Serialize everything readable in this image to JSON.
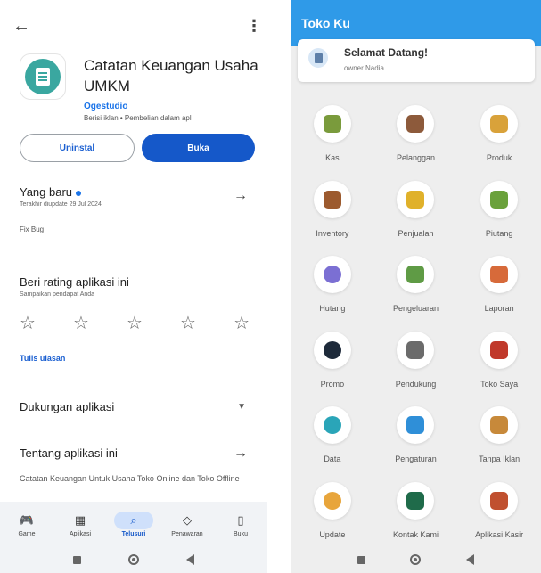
{
  "playstore": {
    "app_title": "Catatan Keuangan Usaha UMKM",
    "developer": "Ogestudio",
    "meta": "Berisi iklan • Pembelian dalam apl",
    "uninstall_label": "Uninstal",
    "open_label": "Buka",
    "whats_new": {
      "title": "Yang baru",
      "updated": "Terakhir diupdate 29 Jul 2024",
      "text": "Fix Bug"
    },
    "rate": {
      "title": "Beri rating aplikasi ini",
      "subtitle": "Sampaikan pendapat Anda",
      "star_count": 5,
      "write_review": "Tulis ulasan"
    },
    "support": {
      "title": "Dukungan aplikasi"
    },
    "about": {
      "title": "Tentang aplikasi ini",
      "text": "Catatan Keuangan Untuk Usaha Toko Online dan Toko Offline"
    },
    "bottom_nav": [
      {
        "label": "Game",
        "icon": "gamepad-icon",
        "glyph": "🎮",
        "active": false
      },
      {
        "label": "Aplikasi",
        "icon": "apps-grid-icon",
        "glyph": "▦",
        "active": false
      },
      {
        "label": "Telusuri",
        "icon": "search-icon",
        "glyph": "⌕",
        "active": true
      },
      {
        "label": "Penawaran",
        "icon": "tag-icon",
        "glyph": "◇",
        "active": false
      },
      {
        "label": "Buku",
        "icon": "book-icon",
        "glyph": "▯",
        "active": false
      }
    ]
  },
  "tokoku": {
    "app_bar_title": "Toko Ku",
    "welcome_title": "Selamat Datang!",
    "welcome_subtitle": "owner Nadia",
    "menu": [
      {
        "label": "Kas",
        "icon": "money-bag-icon",
        "color": "#7a9b3c"
      },
      {
        "label": "Pelanggan",
        "icon": "customer-icon",
        "color": "#8d5a3b"
      },
      {
        "label": "Produk",
        "icon": "product-icon",
        "color": "#d9a23a"
      },
      {
        "label": "Inventory",
        "icon": "shelf-icon",
        "color": "#9c5a2e"
      },
      {
        "label": "Penjualan",
        "icon": "cart-icon",
        "color": "#e0b12a"
      },
      {
        "label": "Piutang",
        "icon": "receivable-icon",
        "color": "#6aa13b"
      },
      {
        "label": "Hutang",
        "icon": "debt-globe-icon",
        "color": "#7b6fd3"
      },
      {
        "label": "Pengeluaran",
        "icon": "expense-icon",
        "color": "#5f9b45"
      },
      {
        "label": "Laporan",
        "icon": "report-chart-icon",
        "color": "#d76a3a"
      },
      {
        "label": "Promo",
        "icon": "megaphone-icon",
        "color": "#1e2a3a"
      },
      {
        "label": "Pendukung",
        "icon": "printer-icon",
        "color": "#6b6b6b"
      },
      {
        "label": "Toko Saya",
        "icon": "store-icon",
        "color": "#c0392b"
      },
      {
        "label": "Data",
        "icon": "data-icon",
        "color": "#2aa5b8"
      },
      {
        "label": "Pengaturan",
        "icon": "settings-gear-icon",
        "color": "#2f8fd8"
      },
      {
        "label": "Tanpa Iklan",
        "icon": "badge-icon",
        "color": "#c7893a"
      },
      {
        "label": "Update",
        "icon": "update-box-icon",
        "color": "#e8a53b"
      },
      {
        "label": "Kontak Kami",
        "icon": "contact-icon",
        "color": "#1f6b4a"
      },
      {
        "label": "Aplikasi Kasir",
        "icon": "cashier-app-icon",
        "color": "#c0502f"
      }
    ]
  }
}
